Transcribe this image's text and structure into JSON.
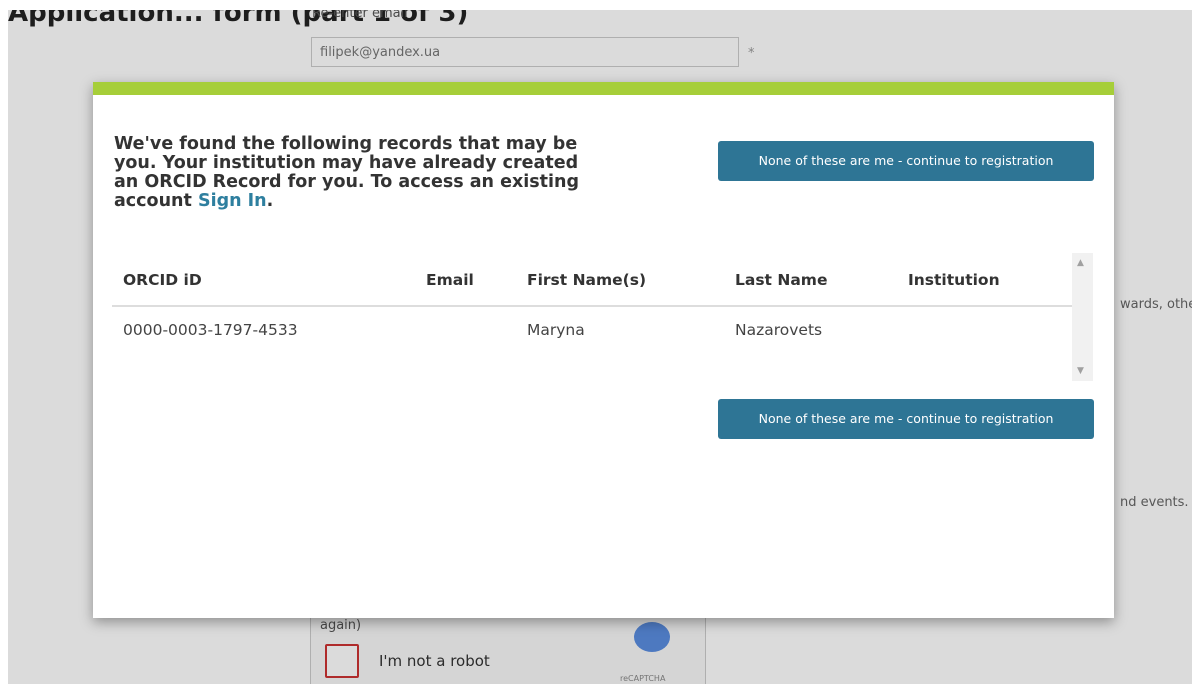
{
  "background": {
    "heading": "Application... form (part 1 of 3)",
    "reenter_email_label": "Re-enter email",
    "reenter_email_value": "filipek@yandex.ua",
    "required_marker": "*",
    "side_text_1": "wards, othe",
    "side_text_2": "nd events.",
    "captcha_again": "again)",
    "captcha_label": "I'm not a robot",
    "captcha_brand": "reCAPTCHA"
  },
  "modal": {
    "message_prefix": "We've found the following records that may be you. Your institution may have already created an ORCID Record for you. To access an existing account ",
    "sign_in_label": "Sign In",
    "message_suffix": ".",
    "continue_button_label": "None of these are me - continue to registration",
    "table": {
      "headers": {
        "orcid": "ORCID iD",
        "email": "Email",
        "first_name": "First Name(s)",
        "last_name": "Last Name",
        "institution": "Institution"
      },
      "rows": [
        {
          "orcid": "0000-0003-1797-4533",
          "email": "",
          "first_name": "Maryna",
          "last_name": "Nazarovets",
          "institution": ""
        }
      ]
    },
    "scroll_up_icon": "▲",
    "scroll_down_icon": "▼"
  },
  "colors": {
    "accent_bar": "#a6ce39",
    "button": "#2e7595",
    "link": "#2e7f9f"
  }
}
